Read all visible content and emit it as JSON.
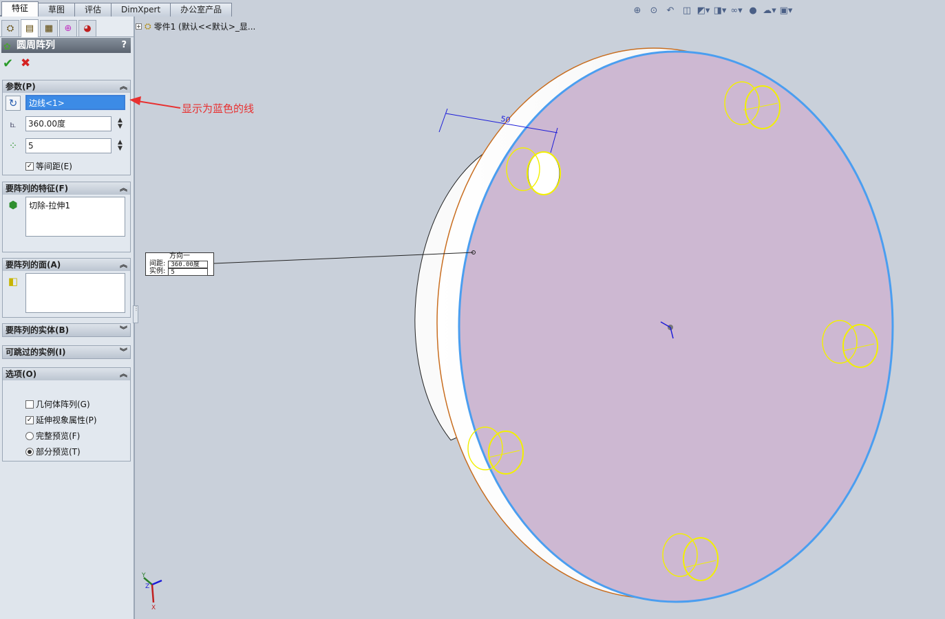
{
  "commandmanager": {
    "tabs": [
      "特征",
      "草图",
      "评估",
      "DimXpert",
      "办公室产品"
    ],
    "active_tab": "特征"
  },
  "feature_tree": {
    "root": "零件1  (默认<<默认>_显..."
  },
  "property_manager": {
    "title": "圆周阵列",
    "help": "?",
    "icons": [
      "featuremanager-icon",
      "propertymanager-icon",
      "configurationmanager-icon",
      "dimxpertmanager-icon",
      "displaymanager-icon"
    ],
    "parameters": {
      "header": "参数(P)",
      "axis_value": "边线<1>",
      "angle_value": "360.00度",
      "instances_value": "5",
      "equal_spacing_label": "等间距(E)",
      "equal_spacing_checked": true
    },
    "features": {
      "header": "要阵列的特征(F)",
      "items": [
        "切除-拉伸1"
      ]
    },
    "faces": {
      "header": "要阵列的面(A)"
    },
    "bodies": {
      "header": "要阵列的实体(B)"
    },
    "skip": {
      "header": "可跳过的实例(I)"
    },
    "options": {
      "header": "选项(O)",
      "geometry_pattern": "几何体阵列(G)",
      "geometry_pattern_checked": false,
      "propagate_visual": "延伸视象属性(P)",
      "propagate_visual_checked": true,
      "full_preview": "完整预览(F)",
      "partial_preview": "部分预览(T)",
      "selected_preview": "部分预览(T)"
    }
  },
  "annotation": {
    "text": "显示为蓝色的线",
    "color": "#e83030"
  },
  "callout": {
    "title": "方向一",
    "spacing_label": "间距:",
    "spacing_value": "360.00度",
    "instances_label": "实例:",
    "instances_value": "5"
  },
  "dimension_value": "50",
  "triad": {
    "x": "X",
    "y": "Y",
    "z": "Z"
  },
  "colors": {
    "face": "#cdb8d2",
    "edge_highlight": "#4a9ef0",
    "preview": "#f2f000",
    "dimension": "#1b1bd8",
    "arrow": "#e83030"
  }
}
